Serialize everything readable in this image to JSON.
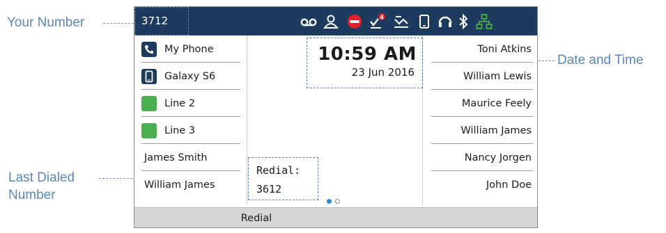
{
  "callouts": {
    "your_number": "Your Number",
    "date_and_time": "Date and Time",
    "last_dialed_line1": "Last Dialed",
    "last_dialed_line2": "Number"
  },
  "status_bar": {
    "extension": "3712",
    "icons": [
      "voicemail-icon",
      "user-presence-icon",
      "do-not-disturb-icon",
      "missed-calls-icon",
      "call-forward-icon",
      "mobile-device-icon",
      "headset-icon",
      "bluetooth-icon",
      "network-icon"
    ],
    "missed_calls_count": "4",
    "colors": {
      "bar": "#1d3a5f",
      "dnd": "#e0202a",
      "badge": "#e0202a",
      "network": "#46b046"
    }
  },
  "line_keys": [
    {
      "label": "My Phone",
      "icon": "phone-icon"
    },
    {
      "label": "Galaxy S6",
      "icon": "mobile-phone-icon"
    },
    {
      "label": "Line 2",
      "icon": "line-status-icon"
    },
    {
      "label": "Line 3",
      "icon": "line-status-icon"
    },
    {
      "label": "James Smith"
    },
    {
      "label": "William James"
    }
  ],
  "speed_dials": [
    "Toni Atkins",
    "William Lewis",
    "Maurice Feely",
    "William James",
    "Nancy Jorgen",
    "John Doe"
  ],
  "clock": {
    "time": "10:59 AM",
    "date": "23 Jun 2016"
  },
  "redial": {
    "label": "Redial:",
    "number": "3612"
  },
  "page_indicator": {
    "current": 1,
    "total": 2
  },
  "softkeys": [
    "Redial"
  ],
  "colors": {
    "line_idle": "#4caf50",
    "icon_dark": "#1d3a5f",
    "page_dot_active": "#2a8ad4"
  }
}
